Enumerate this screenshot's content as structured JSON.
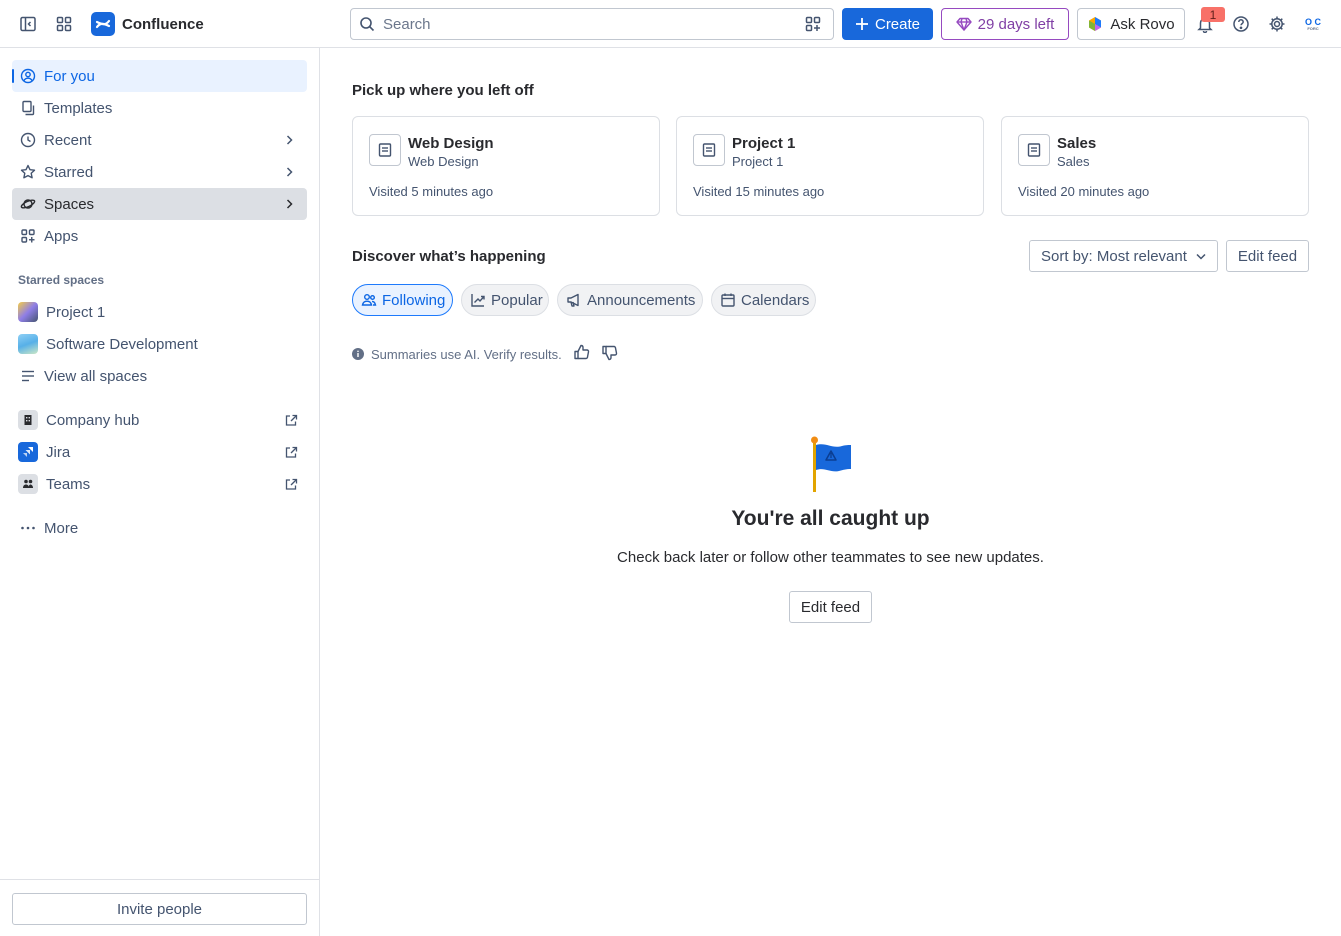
{
  "app": {
    "name": "Confluence",
    "brand_color": "#1868db"
  },
  "header": {
    "search_placeholder": "Search",
    "create_label": "Create",
    "trial_label": "29 days left",
    "rovo_label": "Ask Rovo",
    "notification_count": "1",
    "avatar_initials_top": "O C",
    "avatar_initials_bottom": "FORC"
  },
  "sidebar": {
    "items": [
      {
        "label": "For you",
        "icon": "person-circle-icon"
      },
      {
        "label": "Templates",
        "icon": "template-icon"
      },
      {
        "label": "Recent",
        "icon": "clock-icon"
      },
      {
        "label": "Starred",
        "icon": "star-icon"
      },
      {
        "label": "Spaces",
        "icon": "planet-icon"
      },
      {
        "label": "Apps",
        "icon": "apps-icon"
      }
    ],
    "starred_spaces_label": "Starred spaces",
    "starred_spaces": [
      {
        "label": "Project 1"
      },
      {
        "label": "Software Development"
      }
    ],
    "view_all_label": "View all spaces",
    "links": [
      {
        "label": "Company hub"
      },
      {
        "label": "Jira"
      },
      {
        "label": "Teams"
      }
    ],
    "more_label": "More",
    "invite_label": "Invite people"
  },
  "main": {
    "pickup_title": "Pick up where you left off",
    "recent_cards": [
      {
        "title": "Web Design",
        "space": "Web Design",
        "visited": "Visited 5 minutes ago"
      },
      {
        "title": "Project 1",
        "space": "Project 1",
        "visited": "Visited 15 minutes ago"
      },
      {
        "title": "Sales",
        "space": "Sales",
        "visited": "Visited 20 minutes ago"
      }
    ],
    "discover_title": "Discover what’s happening",
    "sort_label": "Sort by: Most relevant",
    "edit_feed_label": "Edit feed",
    "tabs": [
      {
        "label": "Following",
        "selected": true
      },
      {
        "label": "Popular",
        "selected": false
      },
      {
        "label": "Announcements",
        "selected": false
      },
      {
        "label": "Calendars",
        "selected": false
      }
    ],
    "ai_note": "Summaries use AI. Verify results.",
    "empty_title": "You're all caught up",
    "empty_message": "Check back later or follow other teammates to see new updates.",
    "empty_button": "Edit feed"
  }
}
